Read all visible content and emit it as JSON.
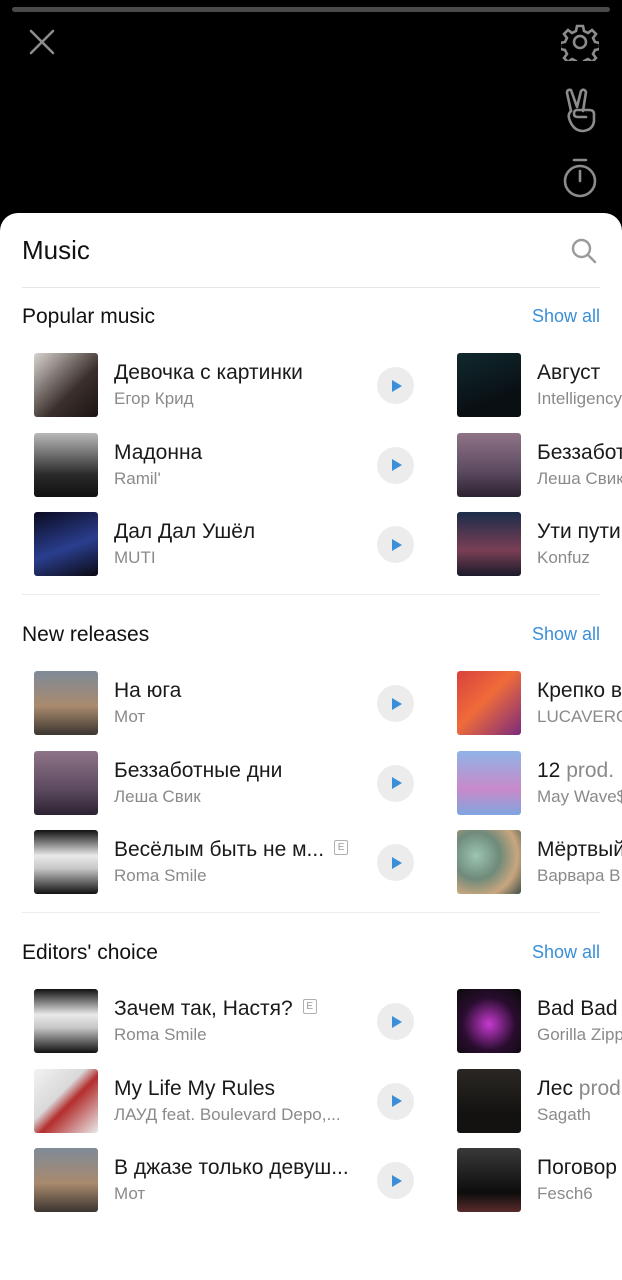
{
  "story_controls": {
    "close_icon": "close-icon",
    "settings_icon": "gear-icon",
    "gesture_icon": "peace-hand-icon",
    "timer_icon": "timer-icon"
  },
  "sheet": {
    "title": "Music",
    "search_icon": "search-icon"
  },
  "sections": [
    {
      "title": "Popular music",
      "show_all": "Show all",
      "left": [
        {
          "title": "Девочка с картинки",
          "artist": "Егор Крид",
          "explicit": false
        },
        {
          "title": "Мадонна",
          "artist": "Ramil'",
          "explicit": false
        },
        {
          "title": "Дал Дал Ушёл",
          "artist": "MUTI",
          "explicit": false
        }
      ],
      "right": [
        {
          "title": "Август",
          "artist": "Intelligency"
        },
        {
          "title": "Беззаботные дни",
          "artist": "Леша Свик"
        },
        {
          "title": "Ути пути",
          "artist": "Konfuz"
        }
      ]
    },
    {
      "title": "New releases",
      "show_all": "Show all",
      "left": [
        {
          "title": "На юга",
          "artist": "Мот",
          "explicit": false
        },
        {
          "title": "Беззаботные дни",
          "artist": "Леша Свик",
          "explicit": false
        },
        {
          "title": "Весёлым быть не м...",
          "artist": "Roma Smile",
          "explicit": true
        }
      ],
      "right": [
        {
          "title": "Крепко в",
          "artist": "LUCAVERO"
        },
        {
          "title": "12",
          "suffix": " prod.",
          "artist": "May Wave$"
        },
        {
          "title": "Мёртвый",
          "artist": "Варвара В"
        }
      ]
    },
    {
      "title": "Editors' choice",
      "show_all": "Show all",
      "left": [
        {
          "title": "Зачем так, Настя?",
          "artist": "Roma Smile",
          "explicit": true
        },
        {
          "title": "My Life My Rules",
          "artist": "ЛАУД feat. Boulevard Depo,...",
          "explicit": false
        },
        {
          "title": "В джазе только девуш...",
          "artist": "Мот",
          "explicit": false
        }
      ],
      "right": [
        {
          "title": "Bad Bad",
          "artist": "Gorilla Zippo"
        },
        {
          "title": "Лес",
          "suffix": " prod",
          "artist": "Sagath"
        },
        {
          "title": "Поговор",
          "artist": "Fesch6"
        }
      ]
    }
  ],
  "explicit_label": "E",
  "colors": {
    "accent": "#3a8fd8",
    "play_bg": "#ececec",
    "play_icon": "#3a8fd8"
  }
}
